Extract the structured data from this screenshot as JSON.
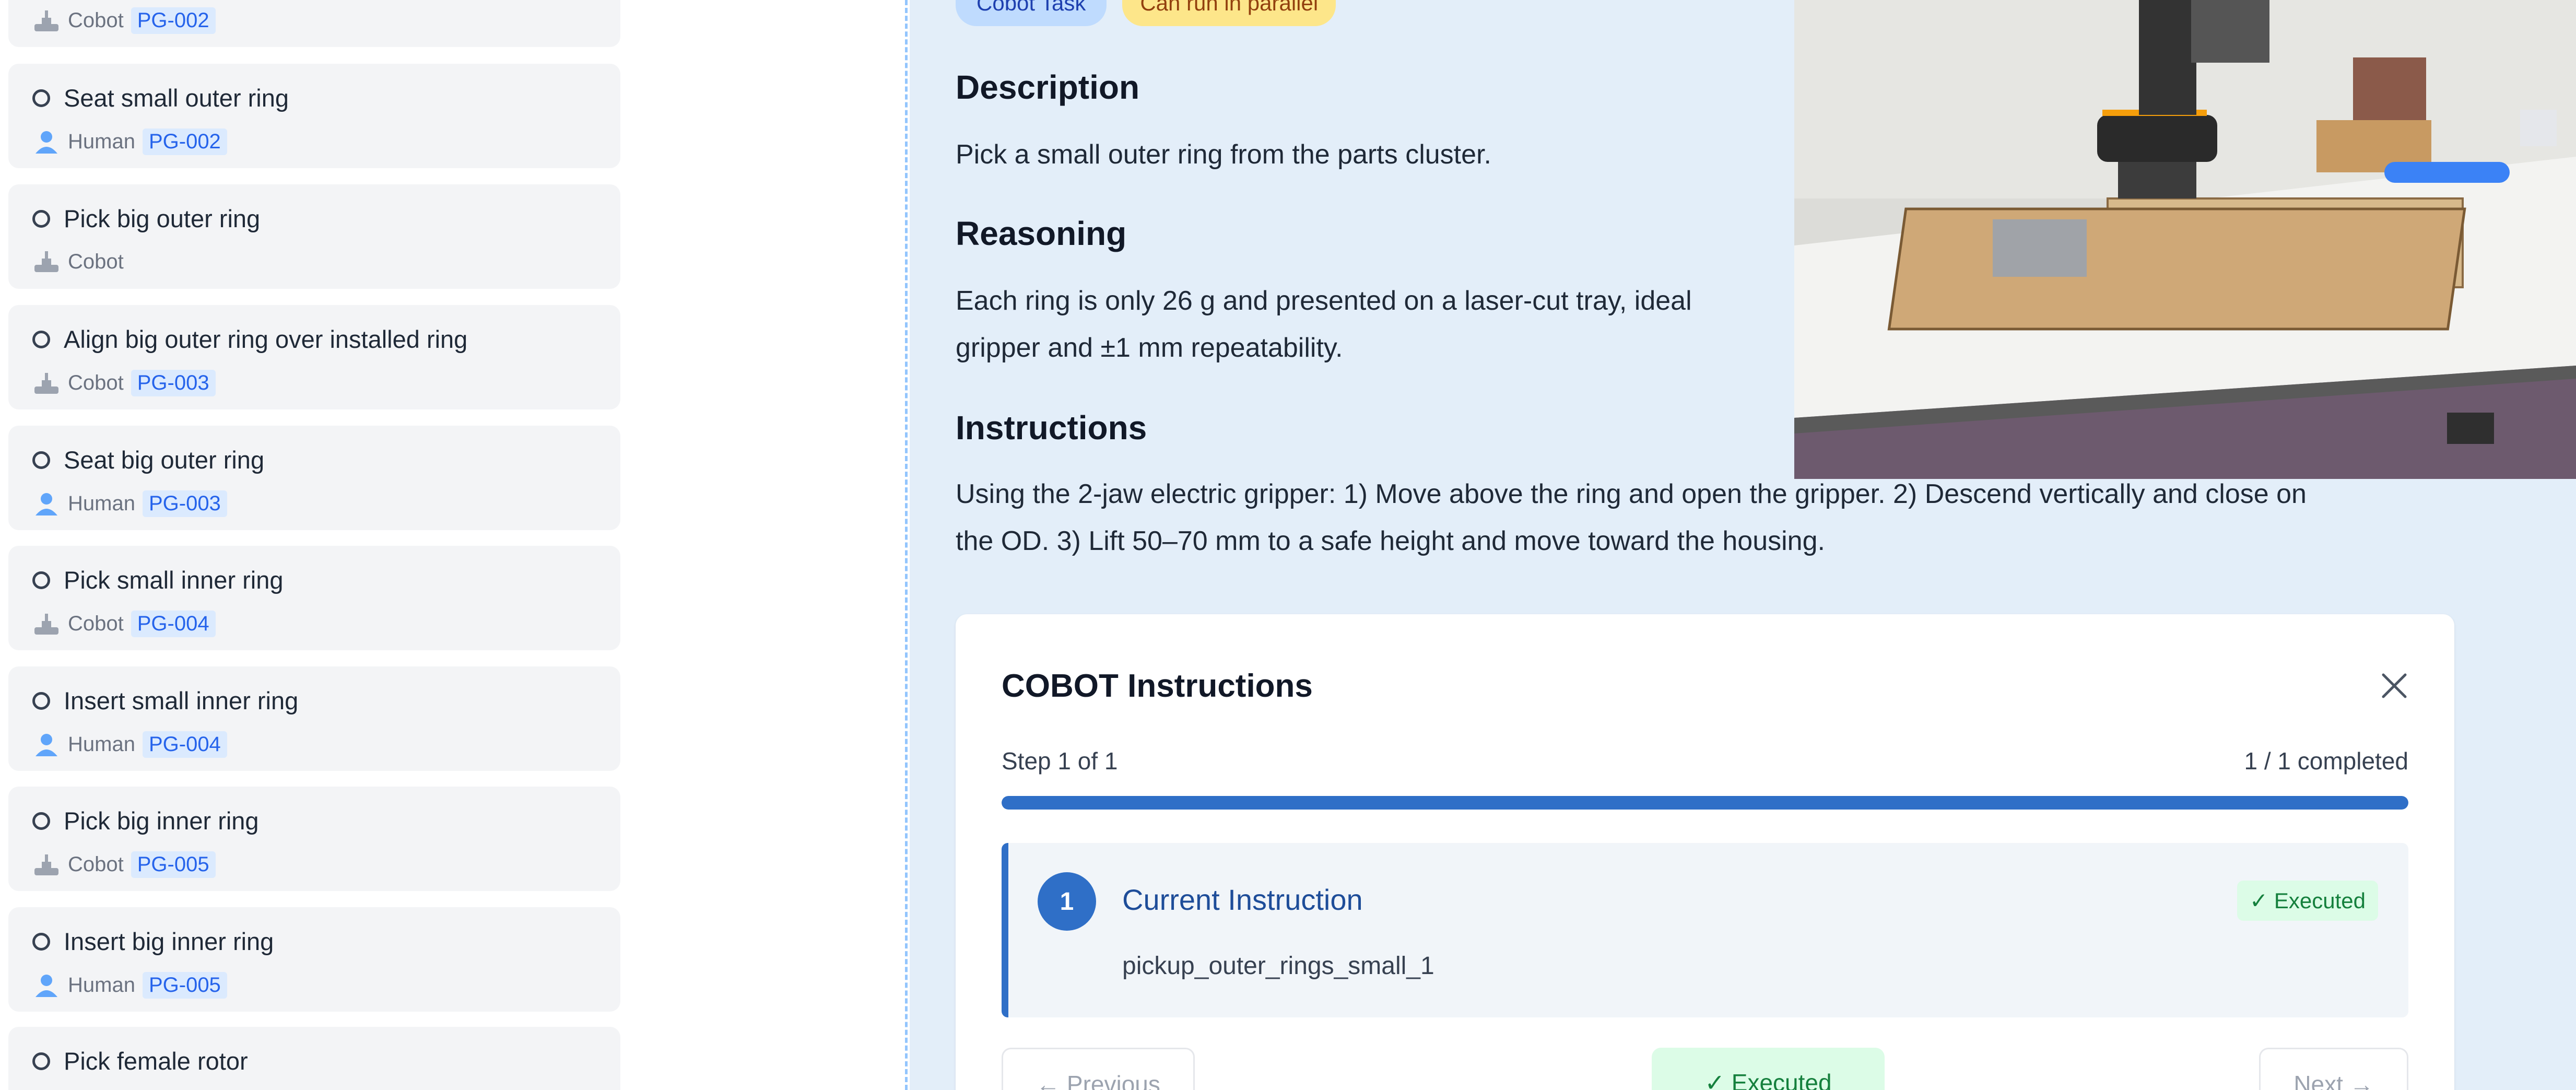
{
  "sidebar": {
    "top_partial": {
      "role": "Cobot",
      "pg": "PG-002"
    },
    "tasks": [
      {
        "title": "Seat small outer ring",
        "role": "Human",
        "pg": "PG-002"
      },
      {
        "title": "Pick big outer ring",
        "role": "Cobot",
        "pg": ""
      },
      {
        "title": "Align big outer ring over installed ring",
        "role": "Cobot",
        "pg": "PG-003"
      },
      {
        "title": "Seat big outer ring",
        "role": "Human",
        "pg": "PG-003"
      },
      {
        "title": "Pick small inner ring",
        "role": "Cobot",
        "pg": "PG-004"
      },
      {
        "title": "Insert small inner ring",
        "role": "Human",
        "pg": "PG-004"
      },
      {
        "title": "Pick big inner ring",
        "role": "Cobot",
        "pg": "PG-005"
      },
      {
        "title": "Insert big inner ring",
        "role": "Human",
        "pg": "PG-005"
      },
      {
        "title": "Pick female rotor",
        "role": "",
        "pg": ""
      }
    ]
  },
  "main": {
    "badges": {
      "type": "Cobot Task",
      "parallel": "Can run in parallel"
    },
    "description": {
      "heading": "Description",
      "text": "Pick a small outer ring from the parts cluster."
    },
    "reasoning": {
      "heading": "Reasoning",
      "line1": "Each ring is only 26 g and presented on a laser-cut tray, ideal",
      "line2": "gripper and ±1 mm repeatability."
    },
    "instructions": {
      "heading": "Instructions",
      "line1": "Using the 2-jaw electric gripper: 1) Move above the ring and open the gripper. 2) Descend vertically and close on",
      "line2": "the OD. 3) Lift 50–70 mm to a safe height and move toward the housing."
    },
    "cobot_panel": {
      "title": "COBOT Instructions",
      "step_label": "Step 1 of 1",
      "completed_label": "1 / 1 completed",
      "progress": 1.0,
      "current": {
        "number": "1",
        "label": "Current Instruction",
        "status": "✓ Executed",
        "code": "pickup_outer_rings_small_1"
      },
      "buttons": {
        "previous": "← Previous",
        "executed": "✓ Executed",
        "next": "Next →"
      }
    }
  },
  "colors": {
    "accent": "#2f6fc7",
    "panel_bg": "#e3eef9",
    "badge_blue": "#dbeafe",
    "success": "#15803d"
  }
}
